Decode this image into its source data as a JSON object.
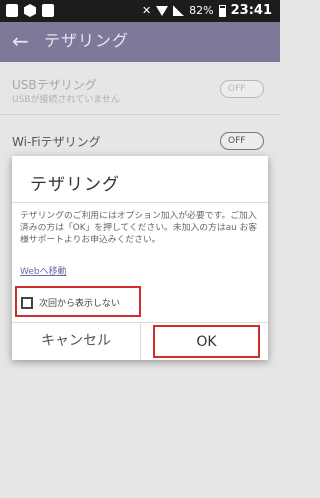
{
  "status_bar": {
    "battery": "82%",
    "time": "23:41",
    "left_icons": [
      "image-icon",
      "hex-app-icon",
      "gallery-icon"
    ],
    "right_icons": [
      "mute-icon",
      "wifi-icon",
      "signal-icon",
      "battery-icon"
    ]
  },
  "toolbar": {
    "back_icon": "←",
    "title": "テザリング"
  },
  "settings": {
    "usb": {
      "title": "USBテザリング",
      "subtitle": "USBが接続されていません",
      "toggle": "OFF"
    },
    "wifi": {
      "title": "Wi-Fiテザリング",
      "toggle": "OFF"
    }
  },
  "dialog": {
    "title": "テザリング",
    "message": "テザリングのご利用にはオプション加入が必要です。ご加入済みの方は「OK」を押してください。未加入の方はau お客様サポートよりお申込みください。",
    "link": "Webへ移動",
    "checkbox_label": "次回から表示しない",
    "checkbox_checked": false,
    "cancel": "キャンセル",
    "ok": "OK",
    "highlight_color": "#d22b2b"
  }
}
